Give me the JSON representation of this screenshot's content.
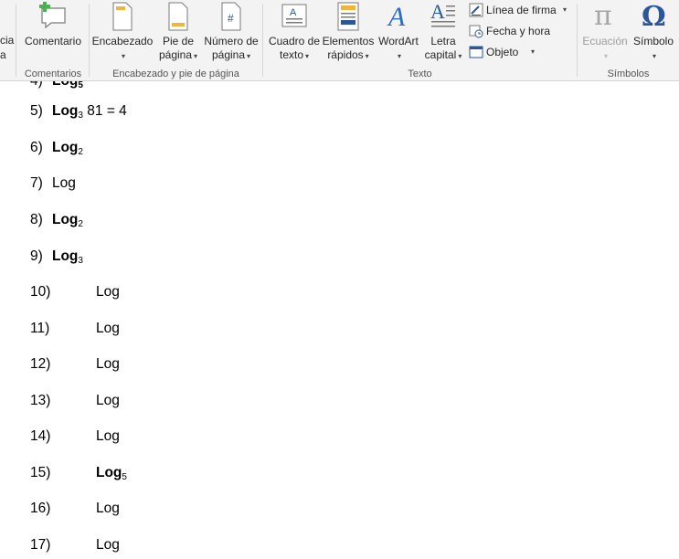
{
  "ribbon": {
    "partial_left": {
      "line1": "cia",
      "line2": "a"
    },
    "comentarios": {
      "button_label": "Comentario",
      "group_label": "Comentarios"
    },
    "header_footer": {
      "encabezado": "Encabezado",
      "pie_line1": "Pie de",
      "pie_line2": "página",
      "numero_line1": "Número de",
      "numero_line2": "página",
      "group_label": "Encabezado y pie de página"
    },
    "texto": {
      "cuadro_line1": "Cuadro de",
      "cuadro_line2": "texto",
      "elementos_line1": "Elementos",
      "elementos_line2": "rápidos",
      "wordart": "WordArt",
      "letra_line1": "Letra",
      "letra_line2": "capital",
      "linea_firma": "Línea de firma",
      "fecha_hora": "Fecha y hora",
      "objeto": "Objeto",
      "group_label": "Texto"
    },
    "simbolos": {
      "ecuacion": "Ecuación",
      "simbolo": "Símbolo",
      "group_label": "Símbolos"
    },
    "colors": {
      "wordart_blue": "#2e6cc7",
      "disabled_gray": "#a6a6a6",
      "symbol_blue": "#2b579a"
    }
  },
  "document": {
    "lines": [
      {
        "num": "5)",
        "log": "Log",
        "sub": "3",
        "rest": " 81 = 4"
      },
      {
        "num": "6)",
        "log": "Log",
        "sub": "2",
        "rest": ""
      },
      {
        "num": "7)",
        "log": "Log",
        "sub": "",
        "rest": ""
      },
      {
        "num": "8)",
        "log": "Log",
        "sub": "2",
        "rest": ""
      },
      {
        "num": "9)",
        "log": "Log",
        "sub": "3",
        "rest": ""
      },
      {
        "num": "10)",
        "log": "Log",
        "sub": "",
        "rest": ""
      },
      {
        "num": "11)",
        "log": "Log",
        "sub": "",
        "rest": ""
      },
      {
        "num": "12)",
        "log": "Log",
        "sub": "",
        "rest": ""
      },
      {
        "num": "13)",
        "log": "Log",
        "sub": "",
        "rest": ""
      },
      {
        "num": "14)",
        "log": "Log",
        "sub": "",
        "rest": ""
      },
      {
        "num": "15)",
        "log": "Log",
        "sub": "5",
        "rest": ""
      },
      {
        "num": "16)",
        "log": "Log",
        "sub": "",
        "rest": ""
      },
      {
        "num": "17)",
        "log": "Log",
        "sub": "",
        "rest": ""
      }
    ]
  }
}
